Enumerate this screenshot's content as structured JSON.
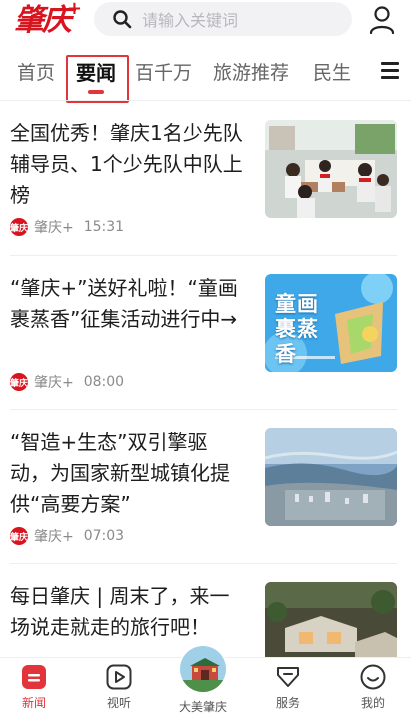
{
  "header": {
    "logo_text": "肇庆",
    "logo_plus": "+",
    "search_placeholder": "请输入关键词"
  },
  "tabs": [
    {
      "label": "首页"
    },
    {
      "label": "要闻",
      "active": true
    },
    {
      "label": "百千万"
    },
    {
      "label": "旅游推荐"
    },
    {
      "label": "民生"
    }
  ],
  "news": [
    {
      "title": "全国优秀！肇庆1名少先队辅导员、1个少先队中队上榜",
      "source": "肇庆+",
      "time": "15:31",
      "thumb": "students-at-table"
    },
    {
      "title": "“肇庆+”送好礼啦！“童画裹蒸香”征集活动进行中→",
      "source": "肇庆+",
      "time": "08:00",
      "thumb": "poster",
      "thumb_text": "童画裹蒸香"
    },
    {
      "title": "“智造+生态”双引擎驱动，为国家新型城镇化提供“高要方案”",
      "source": "肇庆+",
      "time": "07:03",
      "thumb": "aerial-city"
    },
    {
      "title": "每日肇庆 | 周末了，来一场说走就走的旅行吧！",
      "thumb": "resort"
    }
  ],
  "meta_logo_text": "肇庆",
  "bottom_nav": [
    {
      "label": "新闻",
      "icon": "news-icon",
      "active": true
    },
    {
      "label": "视听",
      "icon": "play-icon"
    },
    {
      "label": "大美肇庆",
      "icon": "landmark-icon"
    },
    {
      "label": "服务",
      "icon": "service-icon"
    },
    {
      "label": "我的",
      "icon": "profile-icon"
    }
  ],
  "colors": {
    "accent": "#e2343b",
    "brand": "#d8141f"
  }
}
